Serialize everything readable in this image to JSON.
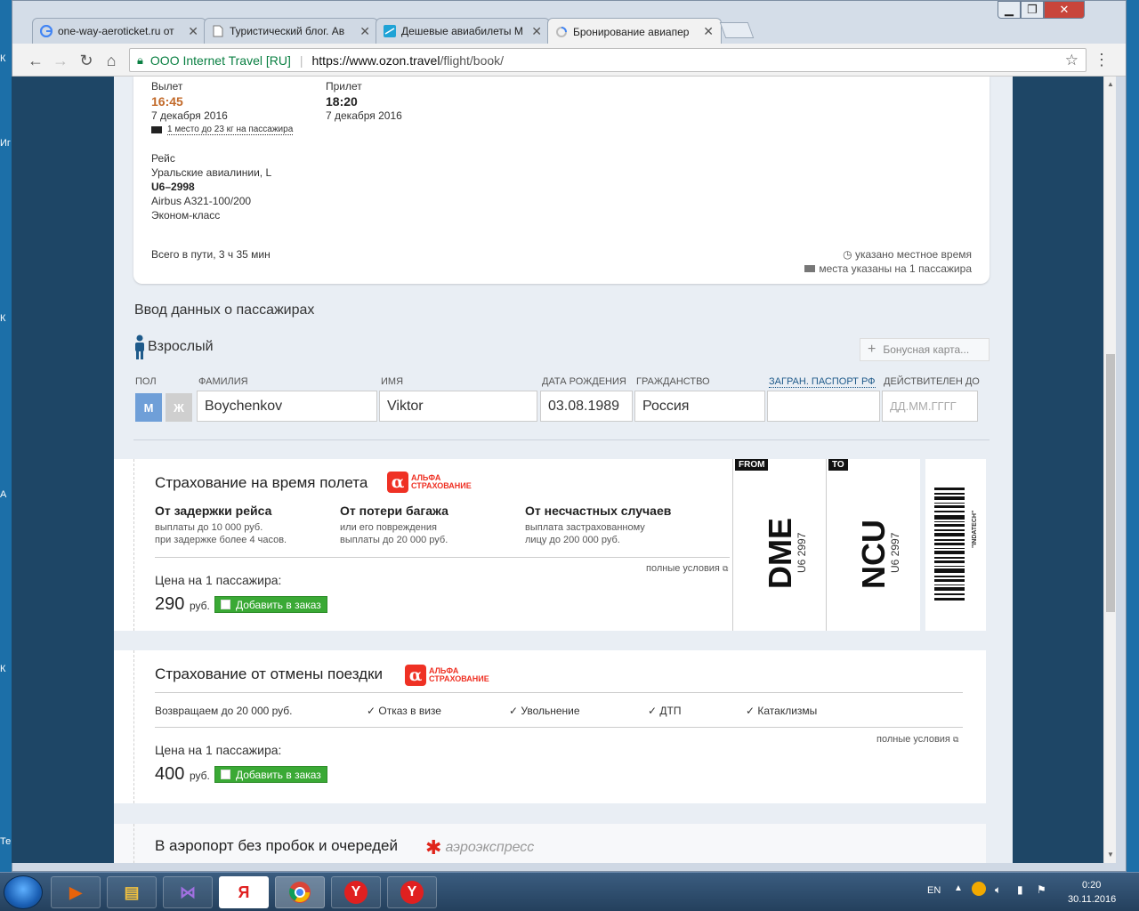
{
  "browser": {
    "tabs": [
      {
        "label": "one-way-aeroticket.ru от",
        "icon": "google-icon"
      },
      {
        "label": "Туристический блог. Ав",
        "icon": "page-icon"
      },
      {
        "label": "Дешевые авиабилеты М",
        "icon": "aviasales-icon"
      },
      {
        "label": "Бронирование авиапер",
        "icon": "loading-icon",
        "active": true
      }
    ],
    "secure_label": "ООО Internet Travel [RU]",
    "url_host": "https://www.ozon.travel",
    "url_path": "/flight/book/"
  },
  "flight": {
    "departure_label": "Вылет",
    "departure_time": "16:45",
    "departure_date": "7 декабря 2016",
    "baggage": "1 место до 23 кг на пассажира",
    "arrival_label": "Прилет",
    "arrival_time": "18:20",
    "arrival_date": "7 декабря 2016",
    "route_label": "Рейс",
    "airline": "Уральские авиалинии, L",
    "flight_number": "U6–2998",
    "aircraft": "Airbus A321-100/200",
    "cabin": "Эконом-класс",
    "total_time": "Всего в пути, 3 ч 35 мин",
    "local_time_note": "указано местное время",
    "seats_note": "места указаны на 1 пассажира"
  },
  "passengers": {
    "title": "Ввод данных о пассажирах",
    "type": "Взрослый",
    "bonus_card": "Бонусная карта...",
    "fields": {
      "gender": "ПОЛ",
      "surname": "ФАМИЛИЯ",
      "name": "ИМЯ",
      "birthdate": "ДАТА РОЖДЕНИЯ",
      "citizenship": "ГРАЖДАНСТВО",
      "passport": "ЗАГРАН. ПАСПОРТ РФ",
      "valid_until": "ДЕЙСТВИТЕЛЕН ДО"
    },
    "gender_m": "М",
    "gender_f": "Ж",
    "values": {
      "surname": "Boychenkov",
      "name": "Viktor",
      "birthdate": "03.08.1989",
      "citizenship": "Россия",
      "passport": "",
      "valid_until_placeholder": "ДД.ММ.ГГГГ"
    }
  },
  "insurance_flight": {
    "title": "Страхование на время полета",
    "brand_line1": "АЛЬФА",
    "brand_line2": "СТРАХОВАНИЕ",
    "items": [
      {
        "title": "От задержки рейса",
        "line1": "выплаты до 10 000 руб.",
        "line2": "при задержке более 4 часов."
      },
      {
        "title": "От потери багажа",
        "line1": "или его повреждения",
        "line2": "выплаты до 20 000 руб."
      },
      {
        "title": "От несчастных случаев",
        "line1": "выплата застрахованному",
        "line2": "лицу до 200 000 руб."
      }
    ],
    "terms": "полные условия",
    "price_label": "Цена на 1 пассажира:",
    "price": "290",
    "currency": "руб.",
    "add_label": "Добавить в заказ",
    "ticket": {
      "from_tag": "FROM",
      "to_tag": "TO",
      "from_code": "DME",
      "to_code": "NCU",
      "flight": "U6 2997",
      "barcode_text": "\"INDATECH\""
    }
  },
  "insurance_cancel": {
    "title": "Страхование от отмены поездки",
    "brand_line1": "АЛЬФА",
    "brand_line2": "СТРАХОВАНИЕ",
    "refund": "Возвращаем до 20 000 руб.",
    "checks": [
      "Отказ в визе",
      "Увольнение",
      "ДТП",
      "Катаклизмы"
    ],
    "terms": "полные условия",
    "price_label": "Цена на 1 пассажира:",
    "price": "400",
    "currency": "руб.",
    "add_label": "Добавить в заказ"
  },
  "aeroexpress": {
    "title": "В аэропорт без пробок и очередей",
    "brand": "аэроэкспресс"
  },
  "taskbar": {
    "lang": "EN",
    "time": "0:20",
    "date": "30.11.2016"
  },
  "desktop_labels": [
    "К",
    "Иг",
    "К",
    "А",
    "К",
    "Те"
  ],
  "colors": {
    "accent_orange": "#c26a2a",
    "add_green": "#3aa935",
    "alfa_red": "#ef3124",
    "gender_active": "#6f9fd8"
  }
}
